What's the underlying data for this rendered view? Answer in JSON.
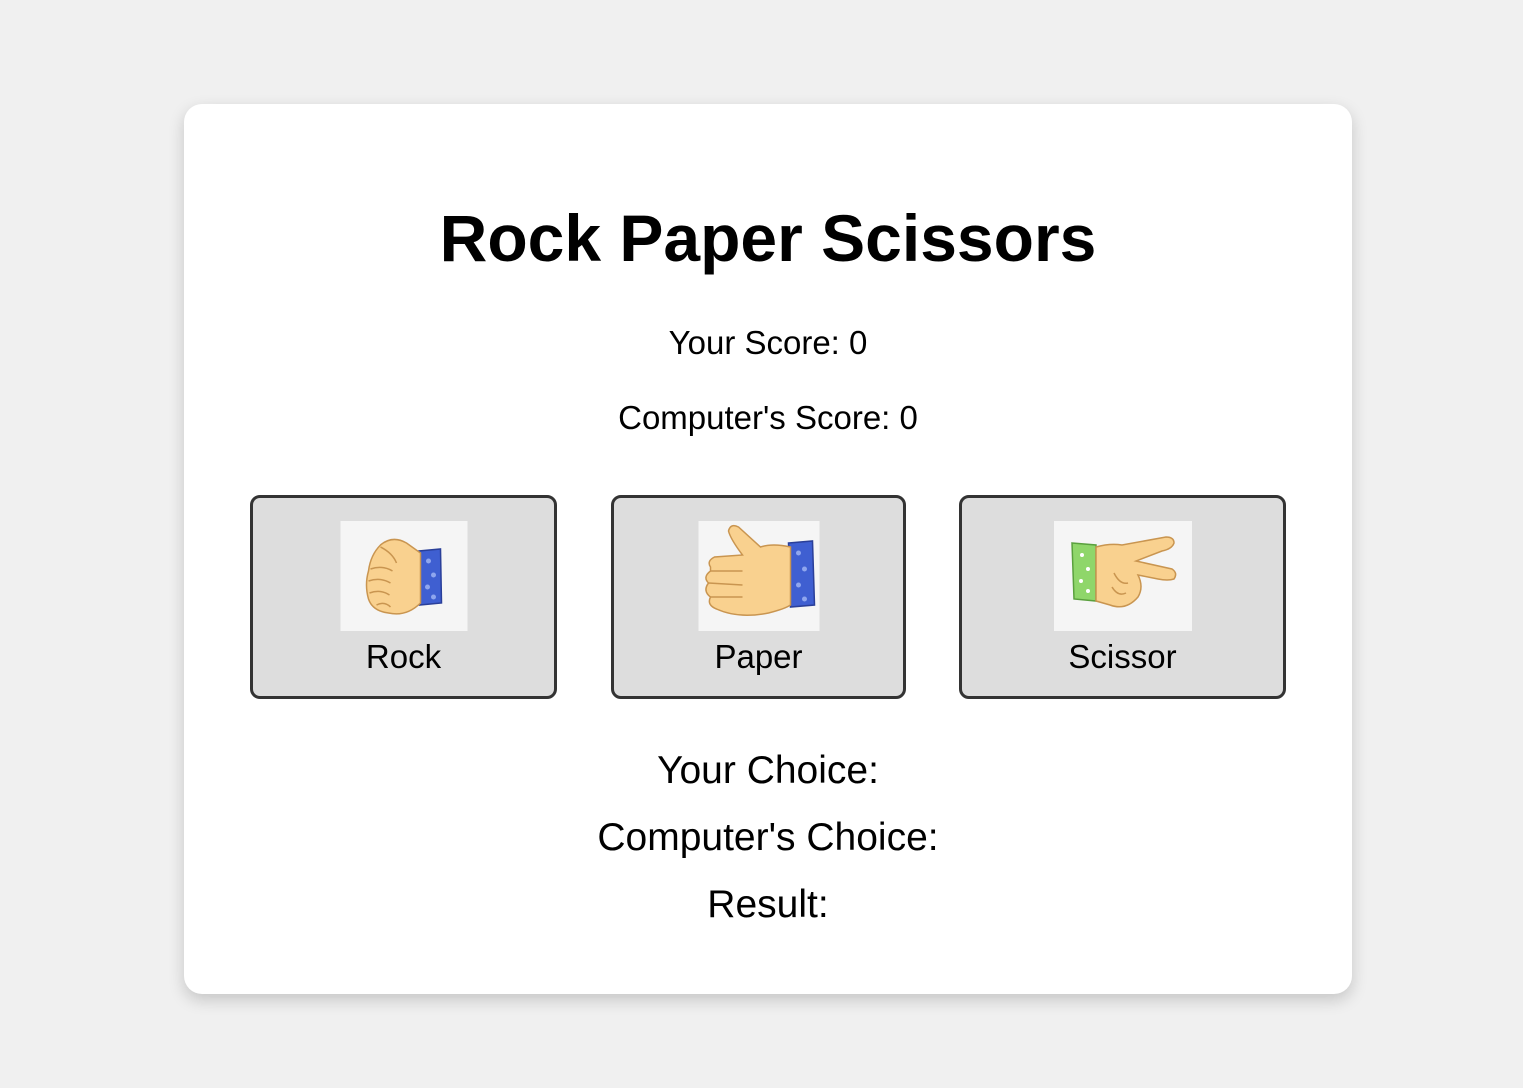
{
  "game": {
    "title": "Rock Paper Scissors",
    "user_score_label": "Your Score: 0",
    "computer_score_label": "Computer's Score: 0",
    "user_score": 0,
    "computer_score": 0
  },
  "choices": [
    {
      "label": "Rock",
      "icon": "fist-hand-icon"
    },
    {
      "label": "Paper",
      "icon": "open-hand-icon"
    },
    {
      "label": "Scissor",
      "icon": "victory-hand-icon"
    }
  ],
  "results": {
    "your_choice_label": "Your Choice:",
    "computer_choice_label": "Computer's Choice:",
    "result_label": "Result:"
  },
  "colors": {
    "page_bg": "#f0f0f0",
    "card_bg": "#ffffff",
    "button_bg": "#dddddd",
    "button_border": "#333333",
    "skin": "#f9d18f",
    "sleeve_blue": "#3f5fd1",
    "sleeve_green": "#8fd66a"
  }
}
